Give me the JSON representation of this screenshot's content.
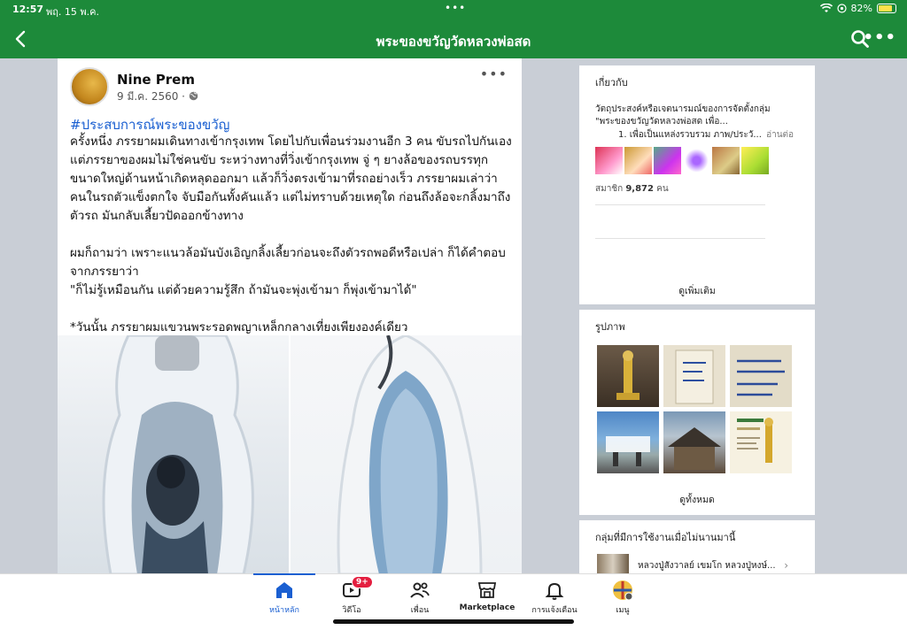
{
  "status_bar": {
    "time": "12:57",
    "date": "พฤ. 15 พ.ค.",
    "battery": "82%",
    "battery_level": 0.82
  },
  "nav": {
    "title": "พระของขวัญวัดหลวงพ่อสด"
  },
  "post": {
    "author": "Nine Prem",
    "date": "9 มี.ค. 2560 ·",
    "hashtag": "#ประสบการณ์พระของขวัญ",
    "para1": "ครั้งหนึ่ง ภรรยาผมเดินทางเข้ากรุงเทพ โดยไปกับเพื่อนร่วมงานอีก 3 คน ขับรถไปกันเอง แต่ภรรยาของผมไม่ใช่คนขับ ระหว่างทางที่วิ่งเข้ากรุงเทพ จู่ ๆ ยางล้อของรถบรรทุกขนาดใหญ่ด้านหน้าเกิดหลุดออกมา แล้วก็วิ่งตรงเข้ามาที่รถอย่างเร็ว ภรรยาผมเล่าว่า คนในรถตัวแข็งตกใจ จับมือกันทั้งคันแล้ว แต่ไม่ทราบด้วยเหตุใด ก่อนถึงล้อจะกลิ้งมาถึงตัวรถ มันกลับเลี้ยวปัดออกข้างทาง",
    "para2_line1": "ผมก็ถามว่า เพราะแนวล้อมันบังเอิญกลิ้งเลี้ยวก่อนจะถึงตัวรถพอดีหรือเปล่า ก็ได้คำตอบจากภรรยาว่า",
    "para2_line2": "\"ก็ไม่รู้เหมือนกัน แต่ด้วยความรู้สึก ถ้ามันจะพุ่งเข้ามา ก็พุ่งเข้ามาได้\"",
    "para3": "*วันนั้น ภรรยาผมแขวนพระรอดพญาเหล็กกลางเที่ยงเพียงองค์เดียว"
  },
  "about": {
    "title": "เกี่ยวกับ",
    "desc1": "วัตถุประสงค์หรือเจตนารมณ์ของการจัดตั้งกลุ่ม",
    "desc2": "\"พระของขวัญวัดหลวงพ่อสด เพื่อ...",
    "desc3": "1. เพื่อเป็นแหล่งรวบรวม ภาพ/ประวั...",
    "read_more": "อ่านต่อ",
    "members_label": "สมาชิก",
    "members_count": "9,872",
    "members_unit": "คน",
    "see_more": "ดูเพิ่มเติม"
  },
  "photos": {
    "title": "รูปภาพ",
    "see_all": "ดูทั้งหมด"
  },
  "active_groups": {
    "title": "กลุ่มที่มีการใช้งานเมื่อไม่นานมานี้",
    "item": "หลวงปู่สังวาลย์ เขมโก หลวงปู่หงษ์..."
  },
  "tabs": {
    "home": "หน้าหลัก",
    "video": "วิดีโอ",
    "video_badge": "9+",
    "friends": "เพื่อน",
    "marketplace": "Marketplace",
    "notifications": "การแจ้งเตือน",
    "menu": "เมนู"
  },
  "colors": {
    "brand_green": "#1d8a3a",
    "link_blue": "#1a5fd1",
    "badge_red": "#e41e3f"
  }
}
